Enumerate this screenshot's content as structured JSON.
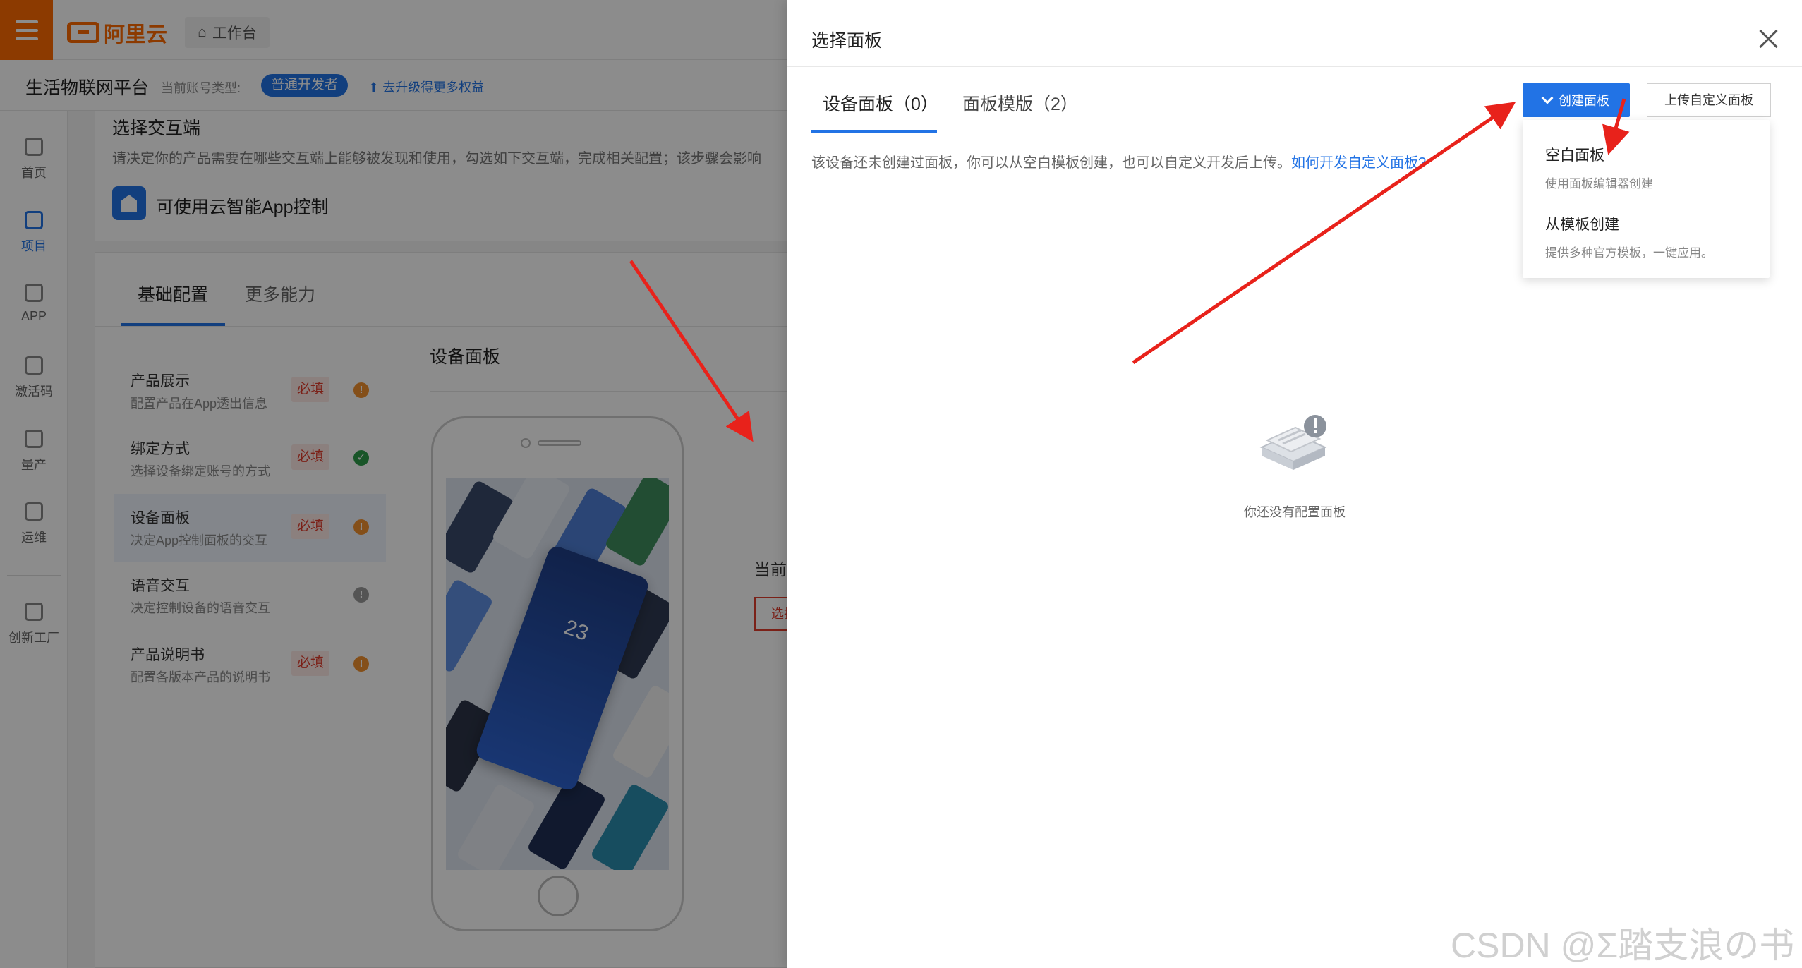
{
  "header": {
    "logo_text": "阿里云",
    "workbench": "工作台",
    "platform": "生活物联网平台",
    "account_type_label": "当前账号类型:",
    "account_badge": "普通开发者",
    "upgrade_link": "去升级得更多权益"
  },
  "nav": [
    {
      "label": "首页"
    },
    {
      "label": "项目"
    },
    {
      "label": "APP"
    },
    {
      "label": "激活码"
    },
    {
      "label": "量产"
    },
    {
      "label": "运维"
    },
    {
      "label": "创新工厂"
    }
  ],
  "background": {
    "section_title": "选择交互端",
    "section_desc": "请决定你的产品需要在哪些交互端上能够被发现和使用，勾选如下交互端，完成相关配置；该步骤会影响",
    "app_label": "可使用云智能App控制",
    "tab_basic": "基础配置",
    "tab_more": "更多能力",
    "steps": [
      {
        "title": "产品展示",
        "desc": "配置产品在App透出信息",
        "required": "必填",
        "status": "!"
      },
      {
        "title": "绑定方式",
        "desc": "选择设备绑定账号的方式",
        "required": "必填",
        "status": "✓"
      },
      {
        "title": "设备面板",
        "desc": "决定App控制面板的交互",
        "required": "必填",
        "status": "!"
      },
      {
        "title": "语音交互",
        "desc": "决定控制设备的语音交互",
        "required": "",
        "status": "!"
      },
      {
        "title": "产品说明书",
        "desc": "配置各版本产品的说明书",
        "required": "必填",
        "status": "!"
      }
    ],
    "panel_title": "设备面板",
    "phone_temp": "23",
    "current_panel": "当前面板",
    "choose_button": "选择面板"
  },
  "drawer": {
    "title": "选择面板",
    "tab_device": "设备面板（0）",
    "tab_template": "面板模版（2）",
    "create_button": "创建面板",
    "upload_button": "上传自定义面板",
    "hint": "该设备还未创建过面板，你可以从空白模板创建，也可以自定义开发后上传。",
    "hint_link": "如何开发自定义面板?",
    "dropdown": [
      {
        "title": "空白面板",
        "desc": "使用面板编辑器创建"
      },
      {
        "title": "从模板创建",
        "desc": "提供多种官方模板，一键应用。"
      }
    ],
    "empty_text": "你还没有配置面板"
  },
  "watermark": "CSDN @Σ踏支浪の书",
  "colors": {
    "brand_orange": "#ff6a00",
    "primary_blue": "#2273e5",
    "annotation_red": "#e8221b",
    "required_red": "#e03c2c"
  }
}
